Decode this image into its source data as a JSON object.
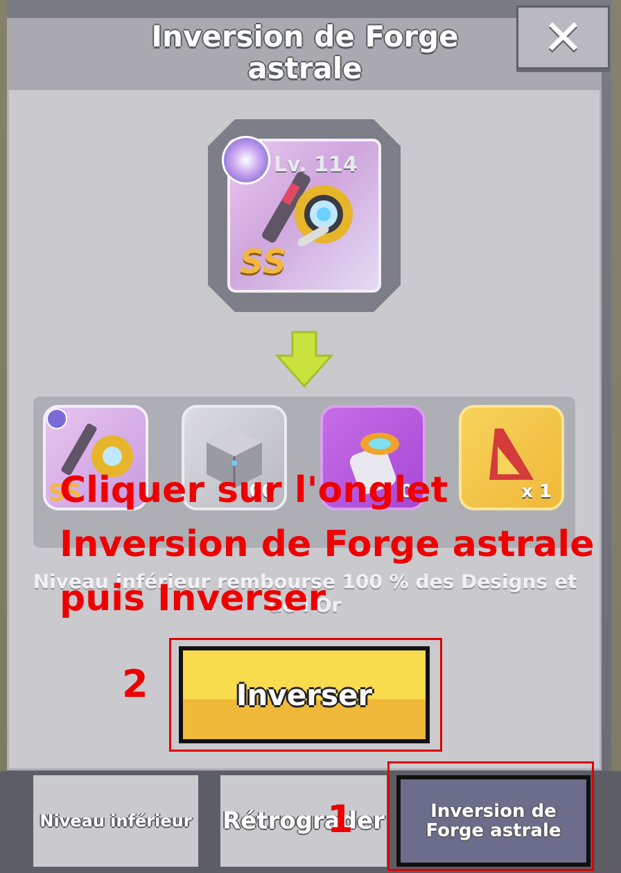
{
  "dialog": {
    "title": "Inversion de Forge astrale",
    "close_label": "✕"
  },
  "item": {
    "level": "Lv. 114",
    "grade": "SS"
  },
  "rewards": [
    {
      "icon": "gear-scepter-icon",
      "quantity": ""
    },
    {
      "icon": "design-cube-icon",
      "quantity": "00"
    },
    {
      "icon": "purple-crystal-icon",
      "quantity": "0"
    },
    {
      "icon": "red-triangle-icon",
      "quantity": "x 1"
    }
  ],
  "info_text": "Niveau inférieur rembourse 100 % des Designs et de l'Or",
  "annotation": {
    "line1": "Cliquer sur l'onglet",
    "line2": "Inversion de Forge astrale",
    "line3": "puis Inverser",
    "step_2": "2",
    "step_1": "1"
  },
  "invert_button_label": "Inverser",
  "tabs": [
    {
      "label": "Niveau inférieur"
    },
    {
      "label": "Rétrograder"
    },
    {
      "label": "Inversion de Forge astrale"
    }
  ],
  "colors": {
    "annotation_red": "#ee0000",
    "button_yellow": "#f8dc4e",
    "active_tab": "#6c6d8a"
  }
}
